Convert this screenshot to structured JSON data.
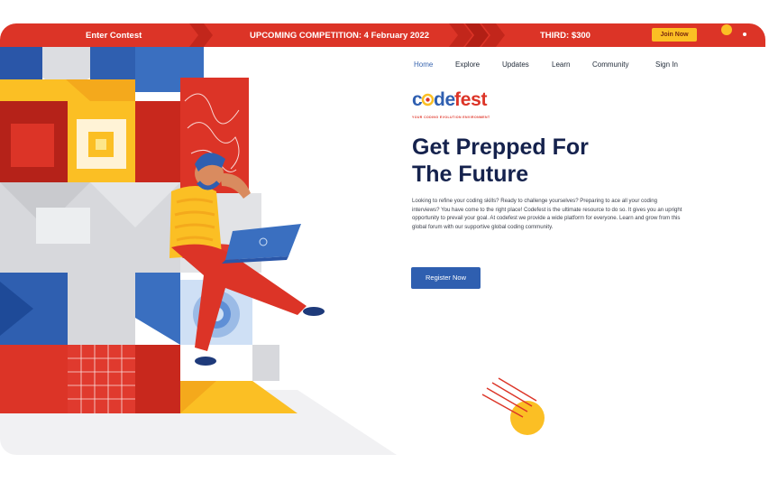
{
  "banner": {
    "enter_contest": "Enter Contest",
    "upcoming": "UPCOMING COMPETITION: 4 February 2022",
    "third_prize": "THIRD: $300",
    "join_label": "Join Now"
  },
  "nav": {
    "items": [
      {
        "label": "Home",
        "active": true
      },
      {
        "label": "Explore"
      },
      {
        "label": "Updates"
      },
      {
        "label": "Learn"
      },
      {
        "label": "Community"
      },
      {
        "label": "Sign In"
      }
    ]
  },
  "logo": {
    "word": "codefest",
    "tagline": "YOUR CODING EVOLUTION ENVIRONMENT"
  },
  "hero": {
    "title_line1": "Get Prepped For",
    "title_line2": "The Future",
    "description": "Looking to refine your coding skills? Ready to challenge yourselves? Preparing to ace all your coding interviews? You have come to the right place! Codefest is the ultimate resource to do so. It gives you an upright opportunity to prevail your goal. At codefest we provide a wide platform for everyone. Learn and grow from this global forum with our supportive global coding community.",
    "register_label": "Register Now"
  },
  "colors": {
    "banner_red": "#dc3427",
    "accent_yellow": "#fbbf24",
    "navy": "#15224d",
    "button_blue": "#2f5fb0"
  }
}
